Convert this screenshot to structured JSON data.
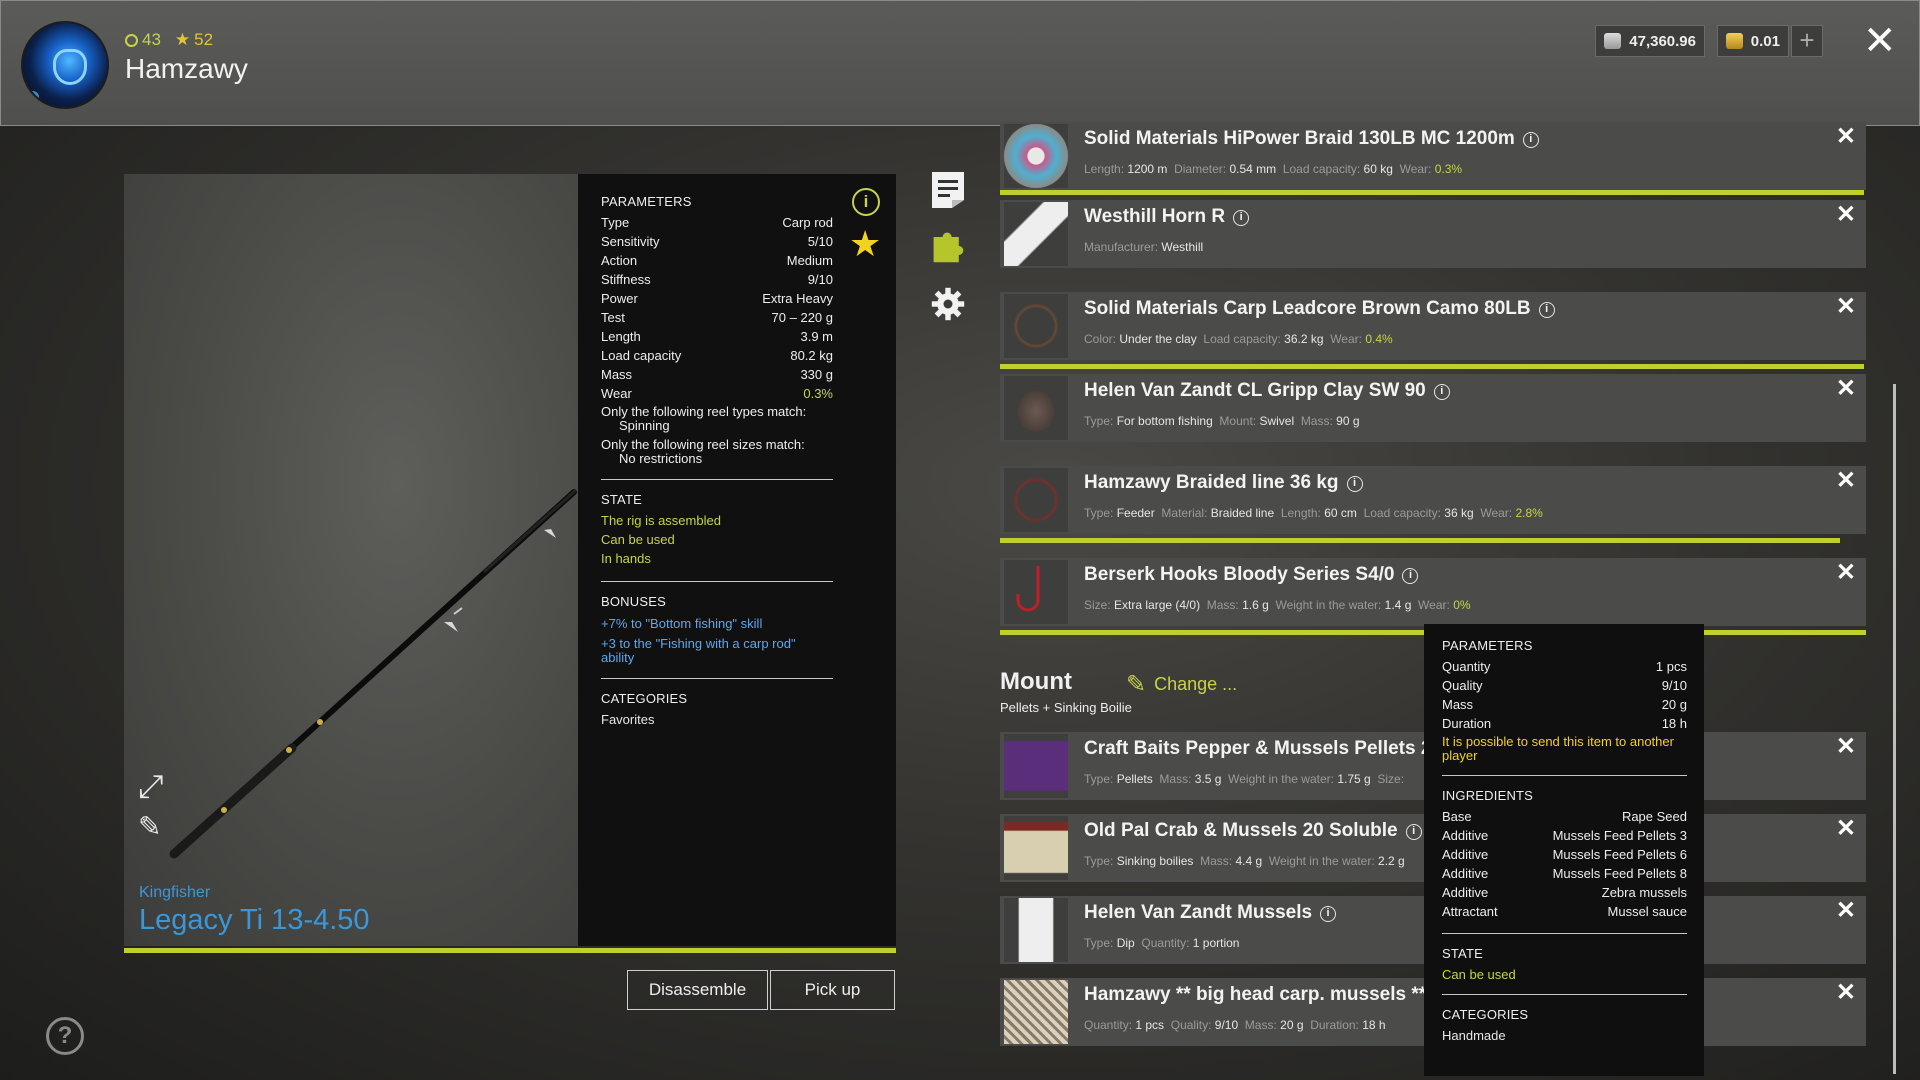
{
  "player": {
    "name": "Hamzawy",
    "level": "43",
    "rank": "52"
  },
  "currency": {
    "silver": "47,360.96",
    "gold": "0.01",
    "add": "+"
  },
  "close_label": "✕",
  "rod": {
    "brand": "Kingfisher",
    "name": "Legacy Ti 13-4.50"
  },
  "params": {
    "header": "PARAMETERS",
    "rows": [
      {
        "label": "Type",
        "value": "Carp rod"
      },
      {
        "label": "Sensitivity",
        "value": "5/10"
      },
      {
        "label": "Action",
        "value": "Medium"
      },
      {
        "label": "Stiffness",
        "value": "9/10"
      },
      {
        "label": "Power",
        "value": "Extra Heavy"
      },
      {
        "label": "Test",
        "value": "70 – 220 g"
      },
      {
        "label": "Length",
        "value": "3.9 m"
      },
      {
        "label": "Load capacity",
        "value": "80.2 kg"
      },
      {
        "label": "Mass",
        "value": "330 g"
      },
      {
        "label": "Wear",
        "value": "0.3%"
      }
    ],
    "reel_types_label": "Only the following reel types match:",
    "reel_types_value": "Spinning",
    "reel_sizes_label": "Only the following reel sizes match:",
    "reel_sizes_value": "No restrictions",
    "state_header": "STATE",
    "state": [
      "The rig is assembled",
      "Can be used",
      "In hands"
    ],
    "bonuses_header": "BONUSES",
    "bonus_1": "+7% to \"Bottom fishing\" skill",
    "bonus_2a": "+3 to the \"Fishing with a carp rod\"",
    "bonus_2b": "ability",
    "categories_header": "CATEGORIES",
    "categories": "Favorites"
  },
  "buttons": {
    "disassemble": "Disassemble",
    "pickup": "Pick up"
  },
  "items": [
    {
      "name": "Solid Materials HiPower Braid 130LB MC 1200m",
      "meta": [
        [
          "Length:",
          "1200 m"
        ],
        [
          "Diameter:",
          "0.54 mm"
        ],
        [
          "Load capacity:",
          "60 kg"
        ]
      ],
      "wear": "0.3%"
    },
    {
      "name": "Westhill Horn R",
      "meta": [
        [
          "Manufacturer:",
          "Westhill"
        ]
      ]
    },
    {
      "name": "Solid Materials Carp Leadcore Brown Camo 80LB",
      "meta": [
        [
          "Color:",
          "Under the clay"
        ],
        [
          "Load capacity:",
          "36.2 kg"
        ]
      ],
      "wear": "0.4%"
    },
    {
      "name": "Helen Van Zandt CL Gripp Clay SW 90",
      "meta": [
        [
          "Type:",
          "For bottom fishing"
        ],
        [
          "Mount:",
          "Swivel"
        ],
        [
          "Mass:",
          "90 g"
        ]
      ]
    },
    {
      "name": "Hamzawy Braided line 36 kg",
      "meta": [
        [
          "Type:",
          "Feeder"
        ],
        [
          "Material:",
          "Braided line"
        ],
        [
          "Length:",
          "60 cm"
        ],
        [
          "Load capacity:",
          "36 kg"
        ]
      ],
      "wear": "2.8%"
    },
    {
      "name": "Berserk Hooks Bloody Series S4/0",
      "meta": [
        [
          "Size:",
          "Extra large (4/0)"
        ],
        [
          "Mass:",
          "1.6 g"
        ],
        [
          "Weight in the water:",
          "1.4 g"
        ]
      ],
      "wear": "0%"
    }
  ],
  "wear_label": "Wear:",
  "mount": {
    "title": "Mount",
    "subtitle": "Pellets + Sinking Boilie",
    "change": "Change ..."
  },
  "mount_items": [
    {
      "name": "Craft Baits Pepper & Mussels Pellets 24",
      "meta": [
        [
          "Type:",
          "Pellets"
        ],
        [
          "Mass:",
          "3.5 g"
        ],
        [
          "Weight in the water:",
          "1.75 g"
        ],
        [
          "Size:",
          ""
        ]
      ]
    },
    {
      "name": "Old Pal Crab & Mussels 20 Soluble",
      "meta": [
        [
          "Type:",
          "Sinking boilies"
        ],
        [
          "Mass:",
          "4.4 g"
        ],
        [
          "Weight in the water:",
          "2.2 g"
        ]
      ]
    },
    {
      "name": "Helen Van Zandt Mussels",
      "meta": [
        [
          "Type:",
          "Dip"
        ],
        [
          "Quantity:",
          "1 portion"
        ]
      ]
    },
    {
      "name": "Hamzawy ** big head carp. mussels **",
      "meta": [
        [
          "Quantity:",
          "1 pcs"
        ],
        [
          "Quality:",
          "9/10"
        ],
        [
          "Mass:",
          "20 g"
        ],
        [
          "Duration:",
          "18 h"
        ]
      ]
    }
  ],
  "tooltip": {
    "header": "PARAMETERS",
    "rows": [
      {
        "label": "Quantity",
        "value": "1 pcs"
      },
      {
        "label": "Quality",
        "value": "9/10"
      },
      {
        "label": "Mass",
        "value": "20 g"
      },
      {
        "label": "Duration",
        "value": "18 h"
      }
    ],
    "note_a": "It is possible to send this item to another",
    "note_b": "player",
    "ingredients_header": "INGREDIENTS",
    "ingredients": [
      {
        "label": "Base",
        "value": "Rape Seed"
      },
      {
        "label": "Additive",
        "value": "Mussels Feed Pellets 3"
      },
      {
        "label": "Additive",
        "value": "Mussels Feed Pellets 6"
      },
      {
        "label": "Additive",
        "value": "Mussels Feed Pellets 8"
      },
      {
        "label": "Additive",
        "value": "Zebra mussels"
      },
      {
        "label": "Attractant",
        "value": "Mussel sauce"
      }
    ],
    "state_header": "STATE",
    "state": "Can be used",
    "categories_header": "CATEGORIES",
    "categories": "Handmade"
  },
  "colors": {
    "accent": "#c0cf2f",
    "rod_name": "#3c97d9",
    "star": "#f0d21f"
  }
}
